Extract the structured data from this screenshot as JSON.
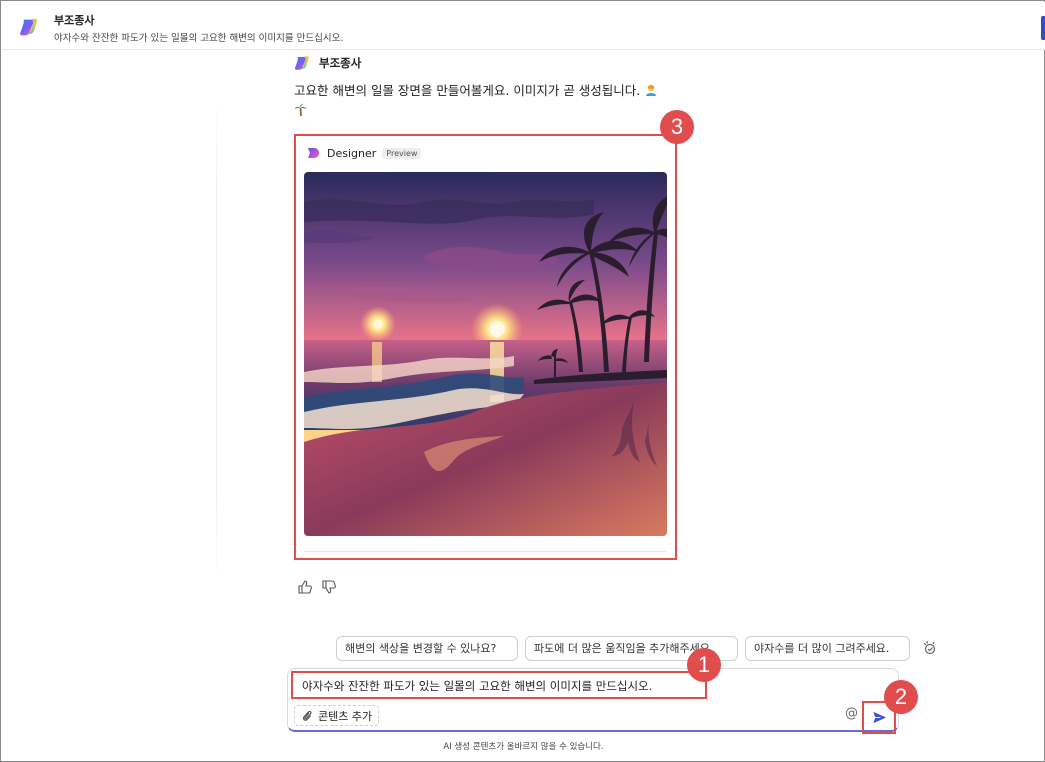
{
  "header": {
    "title": "부조종사",
    "subtitle": "야자수와 잔잔한 파도가 있는 일몰의 고요한 해변의 이미지를 만드십시오."
  },
  "message": {
    "author": "부조종사",
    "text": "고요한 해변의 일몰 장면을 만들어볼게요. 이미지가 곧 생성됩니다.",
    "emojis": [
      "person-icon",
      "palm-tree-icon"
    ]
  },
  "designer_card": {
    "name": "Designer",
    "badge": "Preview",
    "image": "sunset-beach-with-palm-trees"
  },
  "reactions": [
    "thumbs-up-icon",
    "thumbs-down-icon"
  ],
  "suggestions": [
    "해변의 색상을 변경할 수 있나요?",
    "파도에 더 많은 움직임을 추가해주세요.",
    "야자수를 더 많이 그려주세요."
  ],
  "composer": {
    "input_value": "야자수와 잔잔한 파도가 있는 일몰의 고요한 해변의 이미지를 만드십시오.",
    "attach_label": "콘텐츠 추가",
    "at_symbol": "@"
  },
  "disclaimer": "AI 생성 콘텐츠가 올바르지 않을 수 있습니다.",
  "callouts": [
    "1",
    "2",
    "3"
  ],
  "colors": {
    "callout": "#e14c4c",
    "send": "#3b4fd8",
    "composer_accent": "#6a6ae0"
  }
}
